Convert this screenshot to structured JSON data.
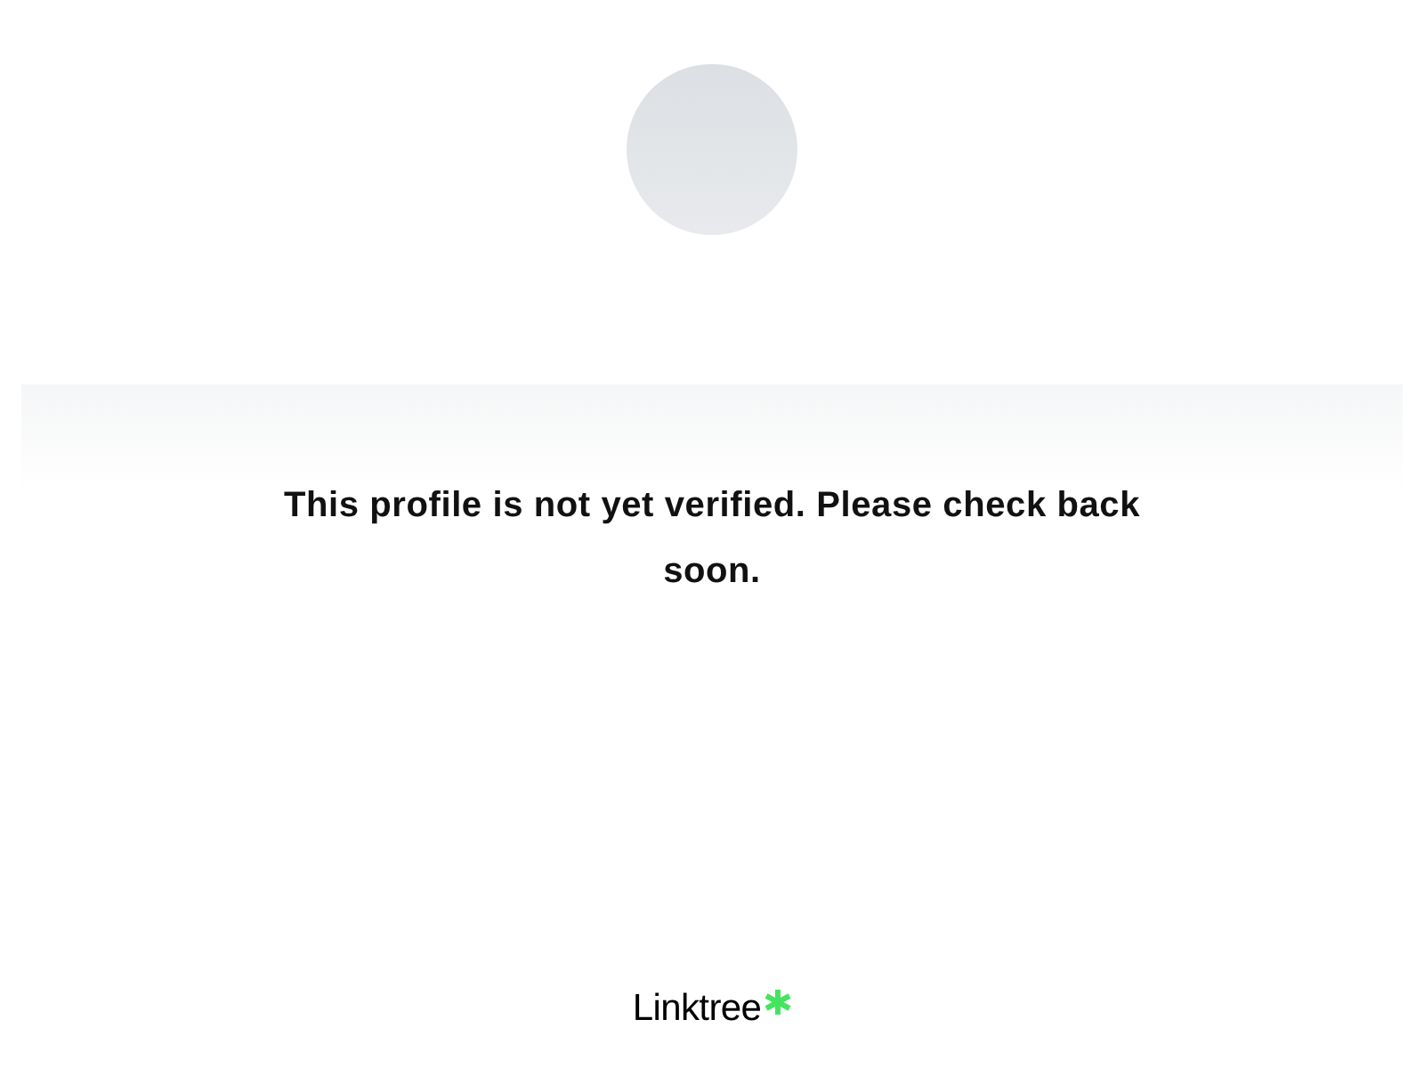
{
  "message": "This profile is not yet verified. Please check back soon.",
  "footer": {
    "logo_text": "Linktree"
  }
}
